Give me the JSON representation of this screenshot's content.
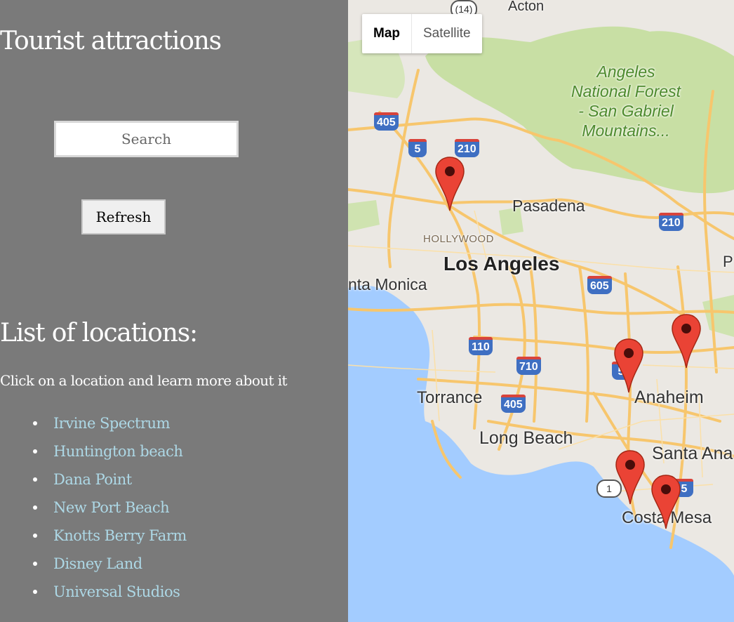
{
  "sidebar": {
    "title": "Tourist attractions",
    "search_placeholder": "Search",
    "refresh_label": "Refresh",
    "list_heading": "List of locations:",
    "list_hint": "Click on a location and learn more about it",
    "locations": [
      "Irvine Spectrum",
      "Huntington beach",
      "Dana Point",
      "New Port Beach",
      "Knotts Berry Farm",
      "Disney Land",
      "Universal Studios"
    ]
  },
  "map": {
    "type_controls": {
      "map_label": "Map",
      "satellite_label": "Satellite",
      "selected": "Map"
    },
    "labels": {
      "acton": "Acton",
      "forest": "Angeles\nNational Forest\n- San Gabriel\nMountains...",
      "pasadena": "Pasadena",
      "hollywood": "HOLLYWOOD",
      "los_angeles": "Los Angeles",
      "santa_monica": "nta Monica",
      "torrance": "Torrance",
      "long_beach": "Long Beach",
      "anaheim": "Anaheim",
      "santa_ana": "Santa Ana",
      "costa_mesa": "Costa Mesa",
      "p_edge": "P"
    },
    "shields": {
      "i405a": "405",
      "i5a": "5",
      "i210a": "210",
      "i210b": "210",
      "i605": "605",
      "i110": "110",
      "i710": "710",
      "i405b": "405",
      "i5b": "5",
      "i5c": "5",
      "r14": "(14)",
      "r1": "1"
    },
    "marker_color": "#ea4335",
    "water_color": "#a3ccff",
    "forest_color": "#c8dfa4",
    "road_color": "#f9c874"
  }
}
